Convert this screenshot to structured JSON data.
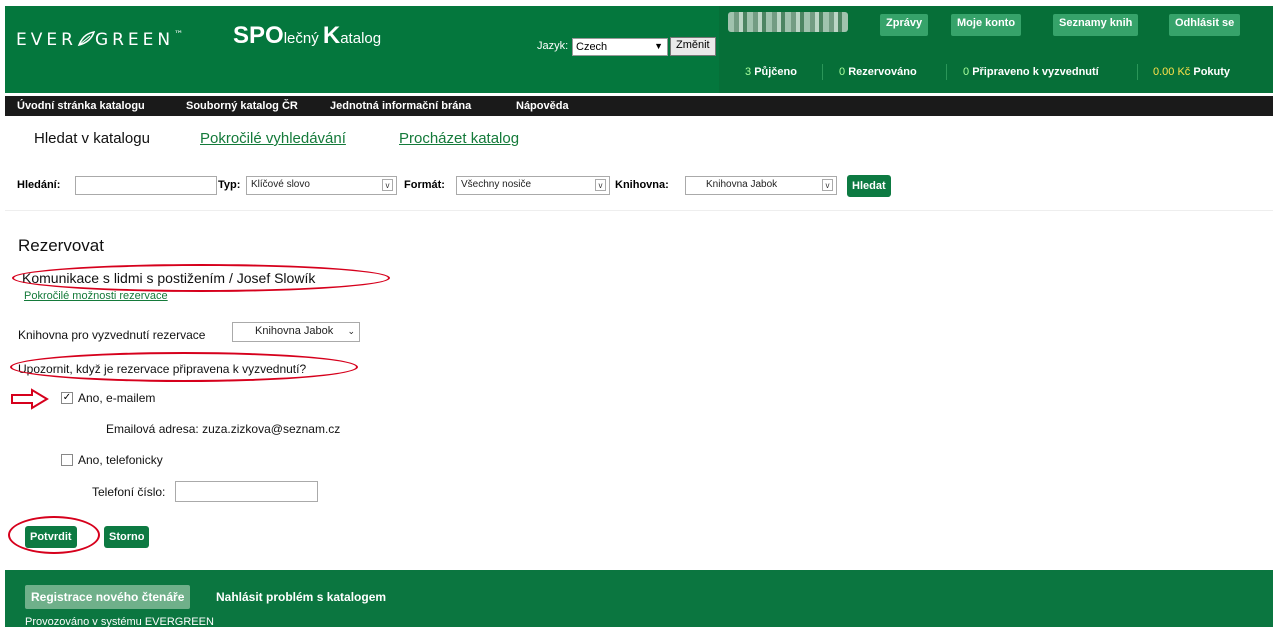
{
  "header": {
    "logo_text": "EVER GREEN",
    "site_big1": "SPO",
    "site_small1": "lečný ",
    "site_big2": "K",
    "site_small2": "atalog",
    "lang_label": "Jazyk:",
    "lang_value": "Czech",
    "change_label": "Změnit",
    "buttons": [
      "Zprávy",
      "Moje konto",
      "Seznamy knih",
      "Odhlásit se"
    ],
    "stats": [
      {
        "num": "3",
        "label": "Půjčeno"
      },
      {
        "num": "0",
        "label": "Rezervováno"
      },
      {
        "num": "0",
        "label": "Připraveno k vyzvednutí"
      },
      {
        "num": "0.00 Kč",
        "label": "Pokuty"
      }
    ]
  },
  "nav": [
    "Úvodní stránka katalogu",
    "Souborný katalog ČR",
    "Jednotná informační brána",
    "Nápověda"
  ],
  "tabs": [
    "Hledat v katalogu",
    "Pokročilé vyhledávání",
    "Procházet katalog"
  ],
  "search": {
    "query_label": "Hledání:",
    "query_value": "",
    "type_label": "Typ:",
    "type_value": "Klíčové slovo",
    "format_label": "Formát:",
    "format_value": "Všechny nosiče",
    "library_label": "Knihovna:",
    "library_value": "Knihovna Jabok",
    "search_button": "Hledat"
  },
  "hold": {
    "title": "Rezervovat",
    "record": "Komunikace s lidmi s postižením / Josef Slowík",
    "advanced_link": "Pokročilé možnosti rezervace",
    "pickup_label": "Knihovna pro vyzvednutí rezervace",
    "pickup_value": "Knihovna Jabok",
    "notify_question": "Upozornit, když je rezervace připravena k vyzvednutí?",
    "email_option": "Ano, e-mailem",
    "email_checked": true,
    "email_address_label": "Emailová adresa:",
    "email_address": "zuza.zizkova@seznam.cz",
    "phone_option": "Ano, telefonicky",
    "phone_checked": false,
    "phone_label": "Telefoní číslo:",
    "phone_value": "",
    "confirm_button": "Potvrdit",
    "cancel_button": "Storno"
  },
  "footer": {
    "register_button": "Registrace nového čtenáře",
    "report_link": "Nahlásit problém s katalogem",
    "powered": "Provozováno v systému EVERGREEN"
  },
  "colors": {
    "header_green": "#04773d",
    "button_green": "#36a36a",
    "link_green": "#147a3a",
    "annotation_red": "#d6001c"
  }
}
